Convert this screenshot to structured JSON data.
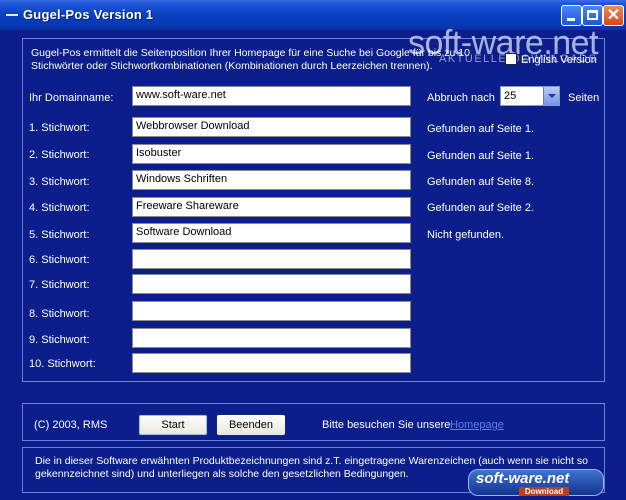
{
  "window": {
    "title": "Gugel-Pos Version 1"
  },
  "intro": {
    "line1": "Gugel-Pos ermittelt die Seitenposition Ihrer Homepage für eine Suche bei Google für bis zu 10",
    "line2": "Stichwörter oder Stichwortkombinationen (Kombinationen durch Leerzeichen trennen)."
  },
  "watermark": {
    "brand": "soft-ware.net",
    "sub": "AKTUELLE DOWNLOADS"
  },
  "options": {
    "english_label": "English Version",
    "english_checked": false
  },
  "domain": {
    "label": "Ihr Domainname:",
    "value": "www.soft-ware.net"
  },
  "abort": {
    "label": "Abbruch nach",
    "value": "25",
    "suffix": "Seiten"
  },
  "keywords": [
    {
      "label": "1. Stichwort:",
      "value": "Webbrowser Download",
      "result": "Gefunden auf Seite 1."
    },
    {
      "label": "2. Stichwort:",
      "value": "Isobuster",
      "result": "Gefunden auf Seite 1."
    },
    {
      "label": "3. Stichwort:",
      "value": "Windows Schriften",
      "result": "Gefunden auf Seite 8."
    },
    {
      "label": "4. Stichwort:",
      "value": "Freeware Shareware",
      "result": "Gefunden auf Seite 2."
    },
    {
      "label": "5. Stichwort:",
      "value": "Software Download",
      "result": "Nicht gefunden."
    },
    {
      "label": "6. Stichwort:",
      "value": "",
      "result": ""
    },
    {
      "label": "7. Stichwort:",
      "value": "",
      "result": ""
    },
    {
      "label": "8. Stichwort:",
      "value": "",
      "result": ""
    },
    {
      "label": "9. Stichwort:",
      "value": "",
      "result": ""
    },
    {
      "label": "10. Stichwort:",
      "value": "",
      "result": ""
    }
  ],
  "bottom": {
    "copyright": "(C) 2003, RMS",
    "start_label": "Start",
    "end_label": "Beenden",
    "visit_text": "Bitte besuchen Sie unsere",
    "link_text": "Homepage"
  },
  "footer": {
    "line1": "Die in dieser Software erwähnten Produktbezeichnungen sind z.T. eingetragene Warenzeichen (auch wenn sie nicht so",
    "line2": "gekennzeichnet sind) und unterliegen als solche den gesetzlichen Bedingungen."
  },
  "logo": {
    "text": "soft-ware.net",
    "sub": "Download"
  },
  "colors": {
    "window_bg": "#0b1e8c",
    "titlebar": "#0a3fc2",
    "link": "#5f7ee8"
  }
}
